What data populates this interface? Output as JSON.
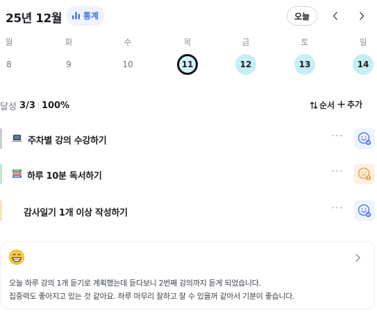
{
  "header": {
    "month": "25년 12월",
    "stats_label": "통계",
    "today_label": "오늘",
    "prev_icon": "chevron-left-icon",
    "next_icon": "chevron-right-icon"
  },
  "week": {
    "weekdays": [
      "월",
      "화",
      "수",
      "목",
      "금",
      "토",
      "일"
    ],
    "days": [
      {
        "num": "8",
        "state": "plain"
      },
      {
        "num": "9",
        "state": "plain"
      },
      {
        "num": "10",
        "state": "plain"
      },
      {
        "num": "11",
        "state": "selected"
      },
      {
        "num": "12",
        "state": "filled"
      },
      {
        "num": "13",
        "state": "filled"
      },
      {
        "num": "14",
        "state": "filled"
      }
    ]
  },
  "progress": {
    "label": "달성",
    "count": "3/3",
    "percent": "100%",
    "order_label": "순서",
    "add_label": "추가"
  },
  "tasks": [
    {
      "title": "주차별 강의 수강하기",
      "icon": "laptop-icon",
      "bar_color": "#c7ccd6",
      "mood": "blue-smile-icon",
      "more": "···"
    },
    {
      "title": "하루 10분 독서하기",
      "icon": "books-icon",
      "bar_color": "#bfe8cf",
      "mood": "orange-face-icon",
      "more": "···"
    },
    {
      "title": "감사일기 1개 이상 작성하기",
      "icon": "",
      "bar_color": "#f7e3b8",
      "mood": "blue-smile-icon",
      "more": "···"
    }
  ],
  "diary": {
    "emoji": "grinning-face-icon",
    "line1": "오늘 하루 강의 1개 듣기로 계획했는데 듣다보니 2번째 강의까지 듣게 되었습니다.",
    "line2": "집중력도 좋아지고 있는 것 같아요. 하루 마무리 잘하고 잘 수 있을꺼 같아서 기분이 좋습니다."
  },
  "colors": {
    "accent_blue": "#3f6fe0",
    "day_fill": "#c6eef5",
    "mood_blue": "#5b7fe8",
    "mood_orange": "#f0a24b"
  }
}
